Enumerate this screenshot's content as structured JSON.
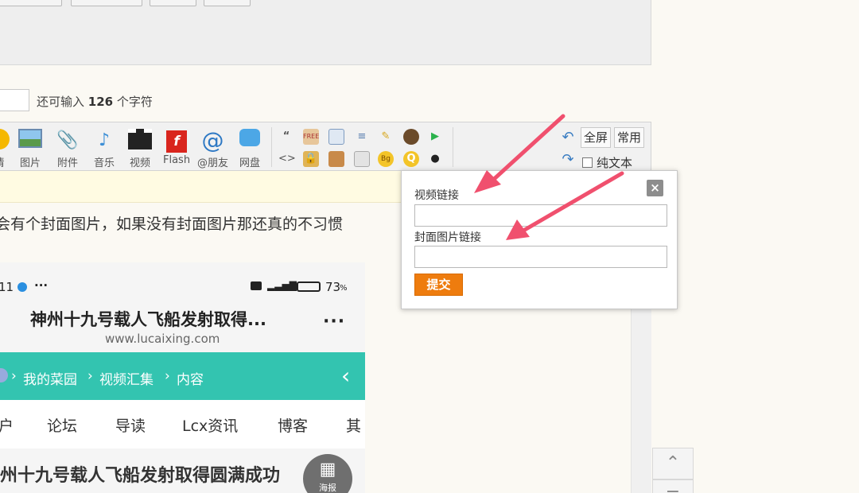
{
  "char_counter": {
    "prefix": "还可输入",
    "count": "126",
    "suffix": "个字符"
  },
  "toolbar": {
    "items": [
      {
        "label": "情"
      },
      {
        "label": "图片"
      },
      {
        "label": "附件"
      },
      {
        "label": "音乐"
      },
      {
        "label": "视频"
      },
      {
        "label": "Flash"
      },
      {
        "label": "@朋友"
      },
      {
        "label": "网盘"
      }
    ],
    "fullscreen_label": "全屏",
    "common_label": "常用",
    "plain_text_label": "纯文本"
  },
  "content": {
    "text": "会有个封面图片，如果没有封面图片那还真的不习惯"
  },
  "phone": {
    "status_left": "11",
    "status_right": "73",
    "title": "神州十九号载人飞船发射取得...",
    "url": "www.lucaixing.com",
    "breadcrumb": [
      "我的菜园",
      "视频汇集",
      "内容"
    ],
    "nav": [
      "户",
      "论坛",
      "导读",
      "Lcx资讯",
      "博客",
      "其"
    ],
    "headline": "州十九号载人飞船发射取得圆满成功",
    "poster_label": "海报"
  },
  "popup": {
    "video_link_label": "视频链接",
    "cover_link_label": "封面图片链接",
    "submit_label": "提交",
    "close_label": "×"
  },
  "colors": {
    "accent_orange": "#ee7c0e",
    "teal": "#33c4b0",
    "arrow_pink": "#f0506e"
  }
}
